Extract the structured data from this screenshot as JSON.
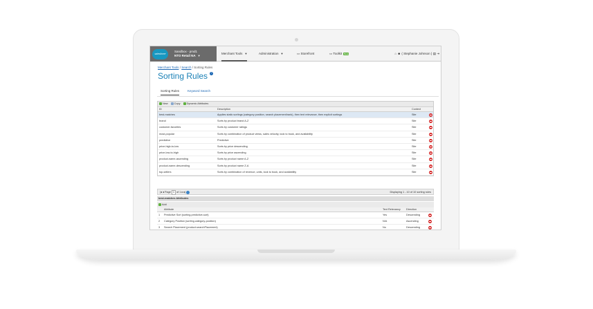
{
  "header": {
    "logo_text": "salesforce",
    "sandbox_label": "Sandbox - pmd1",
    "site_name": "NTO Retail NA",
    "nav": [
      "Merchant Tools",
      "Administration",
      "Storefront",
      "Toolkit"
    ],
    "toolkit_badge": "Beta",
    "user": "( Stephanie   Johnson )"
  },
  "breadcrumb": {
    "items": [
      "Merchant Tools",
      "Search",
      "Sorting Rules"
    ],
    "separator": "/"
  },
  "page": {
    "title": "Sorting Rules"
  },
  "tabs": [
    "Sorting Rules",
    "Keyword Search"
  ],
  "grid": {
    "toolbar": [
      "New",
      "Copy",
      "Dynamic Attributes"
    ],
    "columns": [
      "ID",
      "Description",
      "Context"
    ],
    "rows": [
      {
        "id": "best-matches",
        "description": "Applies static sortings (category position, search placement/rank), then text relevance, then explicit sortings",
        "context": "Site"
      },
      {
        "id": "brand",
        "description": "Sorts by product brand A-Z",
        "context": "Site"
      },
      {
        "id": "customer-favorites",
        "description": "Sorts by customer ratings",
        "context": "Site"
      },
      {
        "id": "most-popular",
        "description": "Sorts by combination of product views, sales velocity, look to book, and availability",
        "context": "Site"
      },
      {
        "id": "predictive",
        "description": "Predictive",
        "context": "Site"
      },
      {
        "id": "price-high-to-low",
        "description": "Sorts by price descending",
        "context": "Site"
      },
      {
        "id": "price-low-to-high",
        "description": "Sorts by price ascending",
        "context": "Site"
      },
      {
        "id": "product-name-ascending",
        "description": "Sorts by product name A-Z",
        "context": "Site"
      },
      {
        "id": "product-name-descending",
        "description": "Sorts by product name Z-A",
        "context": "Site"
      },
      {
        "id": "top-sellers",
        "description": "Sorts by combination of revenue, units, look to book, and availability",
        "context": "Site"
      }
    ]
  },
  "pager": {
    "page_label": "Page",
    "page_value": "1",
    "of_label": "of 1",
    "summary": "Displaying 1 - 10 of 10 sorting rules"
  },
  "sub_panel": {
    "title": "best-matches Attributes",
    "add_label": "Add",
    "columns": [
      "Attribute",
      "Text Relevancy",
      "Direction"
    ],
    "rows": [
      {
        "n": "1",
        "attribute": "Predictive Sort (sorting.predictive-sort)",
        "relevancy": "Yes",
        "direction": "Descending"
      },
      {
        "n": "2",
        "attribute": "Category Position (sorting.category-position)",
        "relevancy": "N/A",
        "direction": "Ascending"
      },
      {
        "n": "3",
        "attribute": "Search Placement (product.searchPlacement)",
        "relevancy": "No",
        "direction": "Descending"
      }
    ]
  },
  "colors": {
    "accent": "#1a80b6",
    "link": "#1a66b3",
    "delete": "#d42525",
    "header_dark": "#6b6b6b"
  }
}
